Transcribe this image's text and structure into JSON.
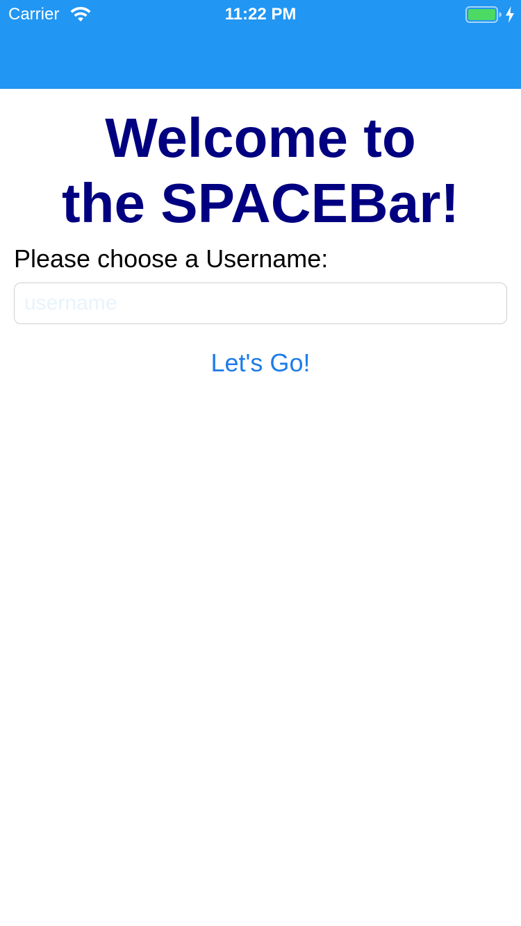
{
  "status_bar": {
    "carrier": "Carrier",
    "time": "11:22 PM",
    "wifi_icon": "wifi-icon",
    "battery_icon": "battery-icon",
    "charging_icon": "charging-bolt-icon",
    "battery_level": 1.0
  },
  "colors": {
    "header_bg": "#2196f3",
    "title": "#000080",
    "button": "#1d7bea",
    "battery_fill": "#4cd964"
  },
  "welcome": {
    "line1": "Welcome to",
    "line2": "the SPACEBar!"
  },
  "form": {
    "label": "Please choose a Username:",
    "username_value": "",
    "username_placeholder": "username",
    "submit_label": "Let's Go!"
  }
}
